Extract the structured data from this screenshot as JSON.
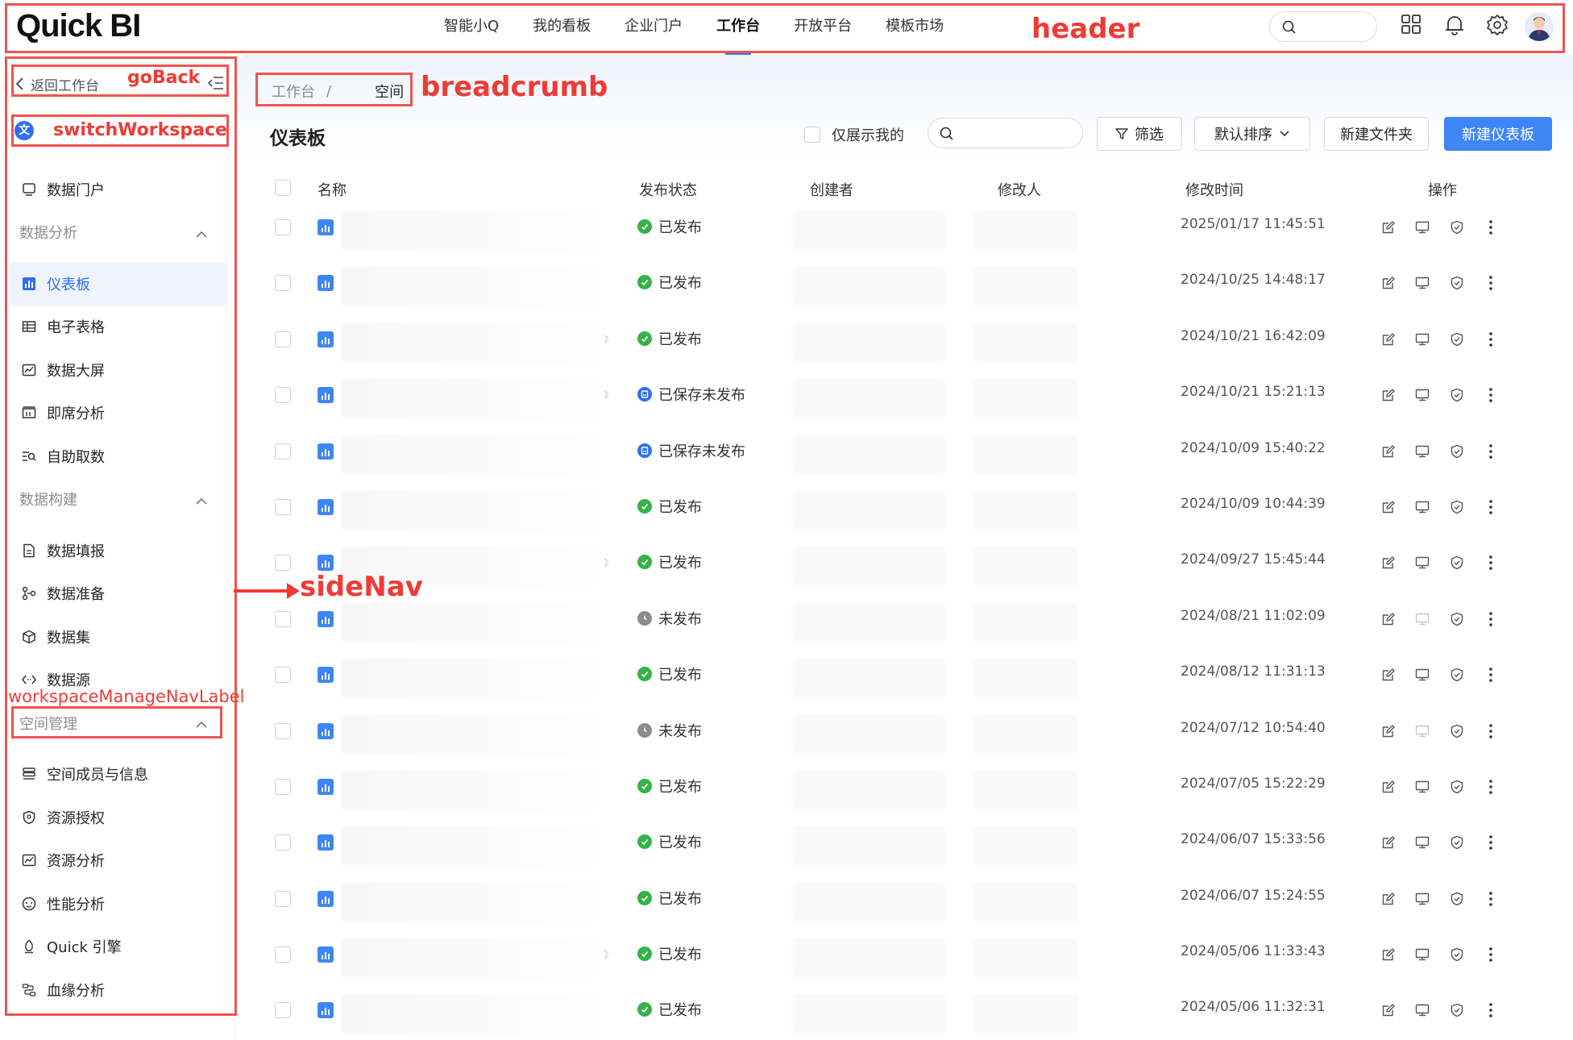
{
  "header": {
    "logo": "Quick BI",
    "nav": [
      "智能小Q",
      "我的看板",
      "企业门户",
      "工作台",
      "开放平台",
      "模板市场"
    ],
    "active_nav": "工作台",
    "search_placeholder": "",
    "avatar_icon": "user-avatar-icon"
  },
  "sidebar": {
    "goback_label": "返回工作台",
    "workspace_icon_char": "文",
    "items_top": [
      {
        "label": "数据门户",
        "icon": "monitor-icon"
      }
    ],
    "groups": [
      {
        "label": "数据分析",
        "items": [
          {
            "label": "仪表板",
            "icon": "dashboard-icon",
            "active": true
          },
          {
            "label": "电子表格",
            "icon": "table-icon"
          },
          {
            "label": "数据大屏",
            "icon": "screen-icon"
          },
          {
            "label": "即席分析",
            "icon": "adhoc-icon"
          },
          {
            "label": "自助取数",
            "icon": "self-service-icon"
          }
        ]
      },
      {
        "label": "数据构建",
        "items": [
          {
            "label": "数据填报",
            "icon": "form-icon"
          },
          {
            "label": "数据准备",
            "icon": "prep-icon"
          },
          {
            "label": "数据集",
            "icon": "cube-icon"
          },
          {
            "label": "数据源",
            "icon": "source-icon"
          }
        ]
      },
      {
        "label": "空间管理",
        "items": [
          {
            "label": "空间成员与信息",
            "icon": "members-icon"
          },
          {
            "label": "资源授权",
            "icon": "shield-icon"
          },
          {
            "label": "资源分析",
            "icon": "chart-icon"
          },
          {
            "label": "性能分析",
            "icon": "gauge-icon"
          },
          {
            "label": "Quick 引擎",
            "icon": "engine-icon"
          },
          {
            "label": "血缘分析",
            "icon": "lineage-icon"
          }
        ]
      }
    ]
  },
  "annotations": {
    "header": "header",
    "goBack": "goBack",
    "switchWorkspace": "switchWorkspace",
    "breadcrumb": "breadcrumb",
    "sideNav": "sideNav",
    "workspaceManageNavLabel": "workspaceManageNavLabel"
  },
  "main": {
    "breadcrumb_parent": "工作台",
    "breadcrumb_sep": "/",
    "breadcrumb_current": "空间",
    "title": "仪表板",
    "only_mine_label": "仅展示我的",
    "search_placeholder": "",
    "filter_label": "筛选",
    "sort_label": "默认排序",
    "new_folder_label": "新建文件夹",
    "new_dashboard_label": "新建仪表板",
    "columns": [
      "名称",
      "发布状态",
      "创建者",
      "修改人",
      "修改时间",
      "操作"
    ],
    "status_colors": {
      "已发布": "#35b34a",
      "已保存未发布": "#2f6ff0",
      "未发布": "#8c8c8c"
    },
    "rows": [
      {
        "status": "已发布",
        "time": "2025/01/17 11:45:51",
        "marker": false,
        "preview_disabled": false
      },
      {
        "status": "已发布",
        "time": "2024/10/25 14:48:17",
        "marker": false,
        "preview_disabled": false
      },
      {
        "status": "已发布",
        "time": "2024/10/21 16:42:09",
        "marker": true,
        "preview_disabled": false
      },
      {
        "status": "已保存未发布",
        "time": "2024/10/21 15:21:13",
        "marker": true,
        "preview_disabled": false
      },
      {
        "status": "已保存未发布",
        "time": "2024/10/09 15:40:22",
        "marker": false,
        "preview_disabled": false
      },
      {
        "status": "已发布",
        "time": "2024/10/09 10:44:39",
        "marker": false,
        "preview_disabled": false
      },
      {
        "status": "已发布",
        "time": "2024/09/27 15:45:44",
        "marker": true,
        "preview_disabled": false
      },
      {
        "status": "未发布",
        "time": "2024/08/21 11:02:09",
        "marker": false,
        "preview_disabled": true
      },
      {
        "status": "已发布",
        "time": "2024/08/12 11:31:13",
        "marker": false,
        "preview_disabled": false
      },
      {
        "status": "未发布",
        "time": "2024/07/12 10:54:40",
        "marker": false,
        "preview_disabled": true
      },
      {
        "status": "已发布",
        "time": "2024/07/05 15:22:29",
        "marker": false,
        "preview_disabled": false
      },
      {
        "status": "已发布",
        "time": "2024/06/07 15:33:56",
        "marker": false,
        "preview_disabled": false
      },
      {
        "status": "已发布",
        "time": "2024/06/07 15:24:55",
        "marker": false,
        "preview_disabled": false
      },
      {
        "status": "已发布",
        "time": "2024/05/06 11:33:43",
        "marker": true,
        "preview_disabled": false
      },
      {
        "status": "已发布",
        "time": "2024/05/06 11:32:31",
        "marker": false,
        "preview_disabled": false
      }
    ]
  }
}
